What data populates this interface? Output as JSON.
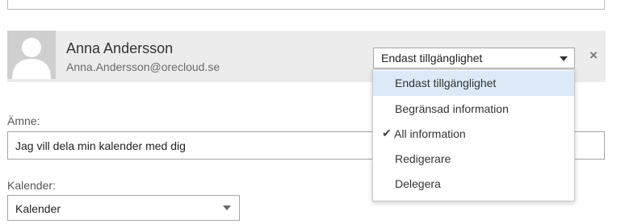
{
  "person": {
    "name": "Anna Andersson",
    "email": "Anna.Andersson@orecloud.se"
  },
  "permission": {
    "selected": "Endast tillgänglighet",
    "options": [
      {
        "label": "Endast tillgänglighet",
        "checked": false,
        "highlighted": true
      },
      {
        "label": "Begränsad information",
        "checked": false,
        "highlighted": false
      },
      {
        "label": "All information",
        "checked": true,
        "highlighted": false
      },
      {
        "label": "Redigerare",
        "checked": false,
        "highlighted": false
      },
      {
        "label": "Delegera",
        "checked": false,
        "highlighted": false
      }
    ],
    "remove_symbol": "×",
    "check_symbol": "✔"
  },
  "subject": {
    "label": "Ämne:",
    "value": "Jag vill dela min kalender med dig"
  },
  "calendar": {
    "label": "Kalender:",
    "selected": "Kalender"
  },
  "colors": {
    "row_background": "#ececec",
    "highlight": "#dce9f7",
    "avatar_background": "#cfcfcf",
    "avatar_silhouette": "#ffffff"
  },
  "icons": {
    "avatar": "person-silhouette-icon",
    "remove": "close-icon",
    "dropdown": "chevron-down-icon",
    "selected_option": "checkmark-icon"
  }
}
